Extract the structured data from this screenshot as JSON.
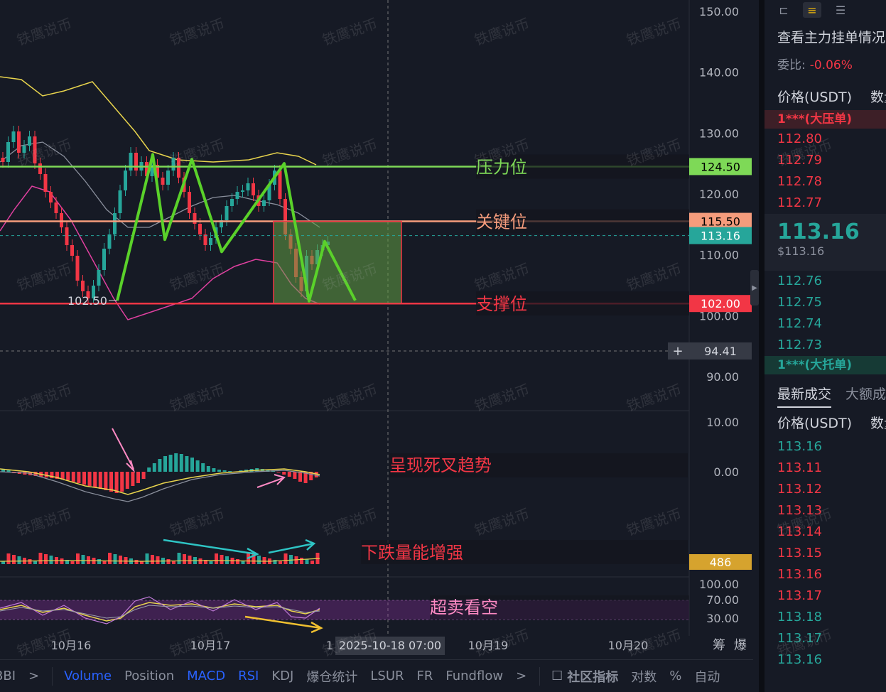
{
  "chart_data": {
    "type": "candlestick",
    "symbol": "",
    "price_axis": {
      "ticks": [
        "150.00",
        "140.00",
        "130.00",
        "120.00",
        "110.00",
        "100.00",
        "90.00"
      ],
      "ylim": [
        90,
        150
      ]
    },
    "time_axis": {
      "ticks": [
        "10月16",
        "10月17",
        "1",
        "10月19",
        "10月20"
      ],
      "crosshair_label": "2025-10-18 07:00"
    },
    "corner_labels": {
      "chips": "筹",
      "liq": "爆"
    },
    "levels": [
      {
        "name": "resistance",
        "label": "压力位",
        "price": 124.5,
        "price_label": "124.50",
        "color": "#7ed957"
      },
      {
        "name": "key",
        "label": "关键位",
        "price": 115.5,
        "price_label": "115.50",
        "color": "#f59c7c"
      },
      {
        "name": "support",
        "label": "支撑位",
        "price": 102.0,
        "price_label": "102.00",
        "color": "#f23645"
      }
    ],
    "last_price": {
      "value": 113.16,
      "label": "113.16"
    },
    "crosshair_price": "94.41",
    "low_marker": {
      "value": 102.5,
      "label": "102.50"
    },
    "zigzag_prices": [
      102.5,
      126.5,
      112.5,
      125.7,
      110.5,
      125.0,
      102.4,
      112.2,
      102.5
    ],
    "projection_box": {
      "top": 115.5,
      "bottom": 102.0
    },
    "macd": {
      "ticks": [
        "10.00",
        "0.00"
      ],
      "annotation": "呈现死叉趋势"
    },
    "volume": {
      "value_label": "486",
      "annotation": "下跌量能增强"
    },
    "rsi": {
      "ticks": [
        "100.00",
        "70.00",
        "30.00"
      ],
      "annotation": "超卖看空"
    }
  },
  "watermark_text": "铁鹰说币",
  "order_book": {
    "title": "查看主力挂单情况",
    "ratio_label": "委比:",
    "ratio_value": "-0.06%",
    "head_price": "价格(USDT)",
    "head_qty": "数量",
    "ask_tag": "1***(大压单)",
    "asks": [
      "112.80",
      "112.79",
      "112.78",
      "112.77"
    ],
    "last_big": "113.16",
    "last_usd": "$113.16",
    "bids": [
      "112.76",
      "112.75",
      "112.74",
      "112.73"
    ],
    "bid_tag": "1***(大托单)",
    "tab_latest": "最新成交",
    "tab_large": "大额成交",
    "trades_head_price": "价格(USDT)",
    "trades_head_qty": "数量",
    "trades": [
      {
        "p": "113.16",
        "c": "green"
      },
      {
        "p": "113.11",
        "c": "red"
      },
      {
        "p": "113.12",
        "c": "red"
      },
      {
        "p": "113.13",
        "c": "red"
      },
      {
        "p": "113.14",
        "c": "red"
      },
      {
        "p": "113.15",
        "c": "red"
      },
      {
        "p": "113.16",
        "c": "red"
      },
      {
        "p": "113.17",
        "c": "red"
      },
      {
        "p": "113.18",
        "c": "green"
      },
      {
        "p": "113.17",
        "c": "green"
      },
      {
        "p": "113.16",
        "c": "green"
      }
    ]
  },
  "toolbar": {
    "items": [
      "BBI",
      ">",
      "Volume",
      "Position",
      "MACD",
      "RSI",
      "KDJ",
      "爆仓统计",
      "LSUR",
      "FR",
      "Fundflow",
      ">"
    ],
    "active": [
      "Volume",
      "MACD",
      "RSI"
    ],
    "community": "社区指标",
    "log": "对数",
    "pct": "%",
    "auto": "自动"
  }
}
